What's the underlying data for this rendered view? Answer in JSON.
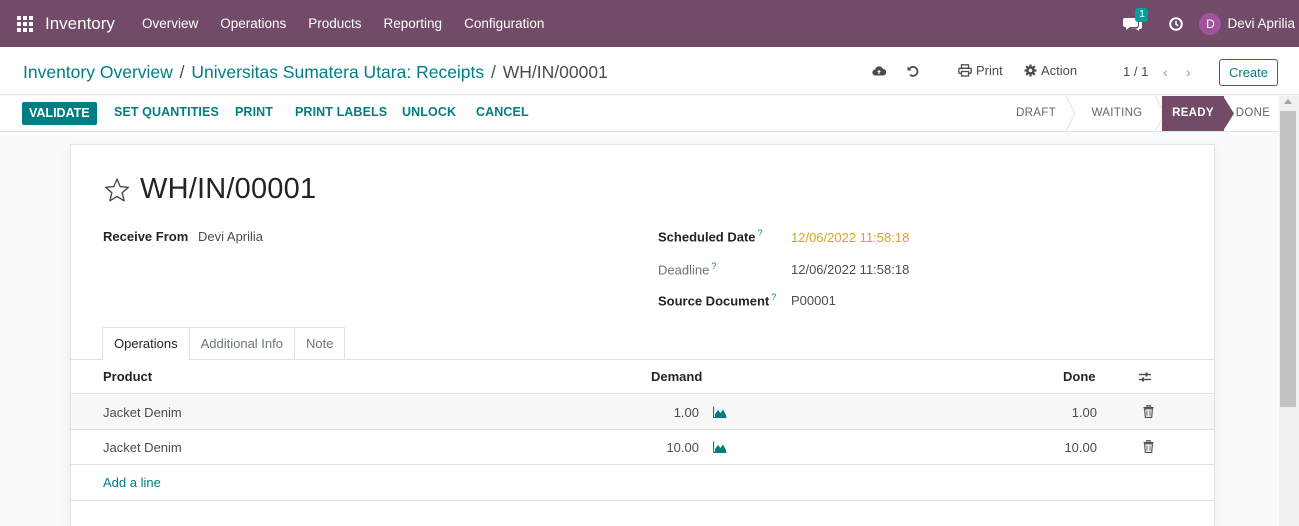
{
  "navbar": {
    "app_name": "Inventory",
    "menu": [
      "Overview",
      "Operations",
      "Products",
      "Reporting",
      "Configuration"
    ],
    "chat_badge": "1",
    "avatar_initial": "D",
    "user_name": "Devi Aprilia",
    "colors": {
      "bar": "#714b67",
      "avatar": "#a2539c",
      "badge": "#00a09d"
    }
  },
  "control_panel": {
    "breadcrumb": [
      "Inventory Overview",
      "Universitas Sumatera Utara: Receipts",
      "WH/IN/00001"
    ],
    "separator": "/",
    "print_label": "Print",
    "action_label": "Action",
    "pager": "1 / 1",
    "create_label": "Create",
    "icons": [
      "cloud-upload-icon",
      "undo-icon",
      "printer-icon",
      "gear-icon",
      "chevron-left-icon",
      "chevron-right-icon"
    ]
  },
  "statusbar": {
    "buttons": [
      "VALIDATE",
      "SET QUANTITIES",
      "PRINT",
      "PRINT LABELS",
      "UNLOCK",
      "CANCEL"
    ],
    "stages": [
      "DRAFT",
      "WAITING",
      "READY",
      "DONE"
    ],
    "active_stage": "READY",
    "accent": "#017e84"
  },
  "form": {
    "title": "WH/IN/00001",
    "receive_from_label": "Receive From",
    "receive_from_value": "Devi Aprilia",
    "scheduled_date_label": "Scheduled Date",
    "scheduled_date_value": "12/06/2022 11:58:18",
    "deadline_label": "Deadline",
    "deadline_value": "12/06/2022 11:58:18",
    "source_document_label": "Source Document",
    "source_document_value": "P00001",
    "help_mark": "?",
    "tabs": [
      "Operations",
      "Additional Info",
      "Note"
    ],
    "table": {
      "headers": {
        "product": "Product",
        "demand": "Demand",
        "done": "Done"
      },
      "rows": [
        {
          "product": "Jacket Denim",
          "demand": "1.00",
          "done": "1.00"
        },
        {
          "product": "Jacket Denim",
          "demand": "10.00",
          "done": "10.00"
        }
      ],
      "add_line": "Add a line"
    }
  }
}
